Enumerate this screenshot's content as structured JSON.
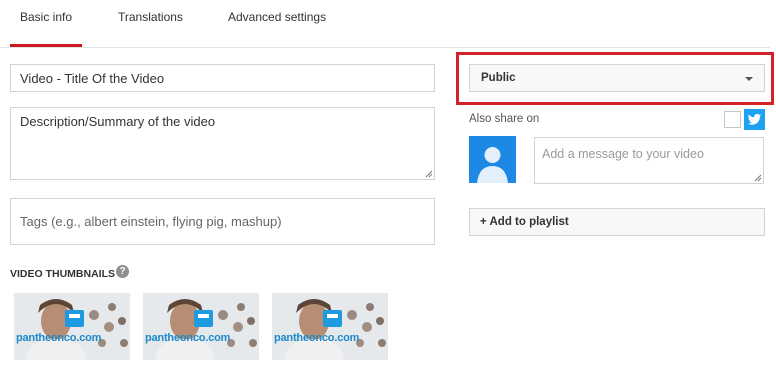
{
  "tabs": [
    {
      "label": "Basic info",
      "active": true
    },
    {
      "label": "Translations",
      "active": false
    },
    {
      "label": "Advanced settings",
      "active": false
    }
  ],
  "form": {
    "title_value": "Video - Title Of the Video",
    "description_value": "Description/Summary of the video",
    "tags_placeholder": "Tags (e.g., albert einstein, flying pig, mashup)"
  },
  "thumbnails": {
    "label": "VIDEO THUMBNAILS",
    "help_icon": "question-mark-icon",
    "items": [
      {
        "brand": "pantheonco.com"
      },
      {
        "brand": "pantheonco.com"
      },
      {
        "brand": "pantheonco.com"
      }
    ]
  },
  "privacy": {
    "selected": "Public",
    "highlight_color": "#d2232a"
  },
  "share": {
    "label": "Also share on",
    "message_placeholder": "Add a message to your video",
    "twitter_color": "#1da1f2",
    "avatar_color": "#1e88e5"
  },
  "playlist": {
    "button_label": "+ Add to playlist"
  },
  "colors": {
    "accent": "#cc181e",
    "border": "#d3d3d3"
  }
}
